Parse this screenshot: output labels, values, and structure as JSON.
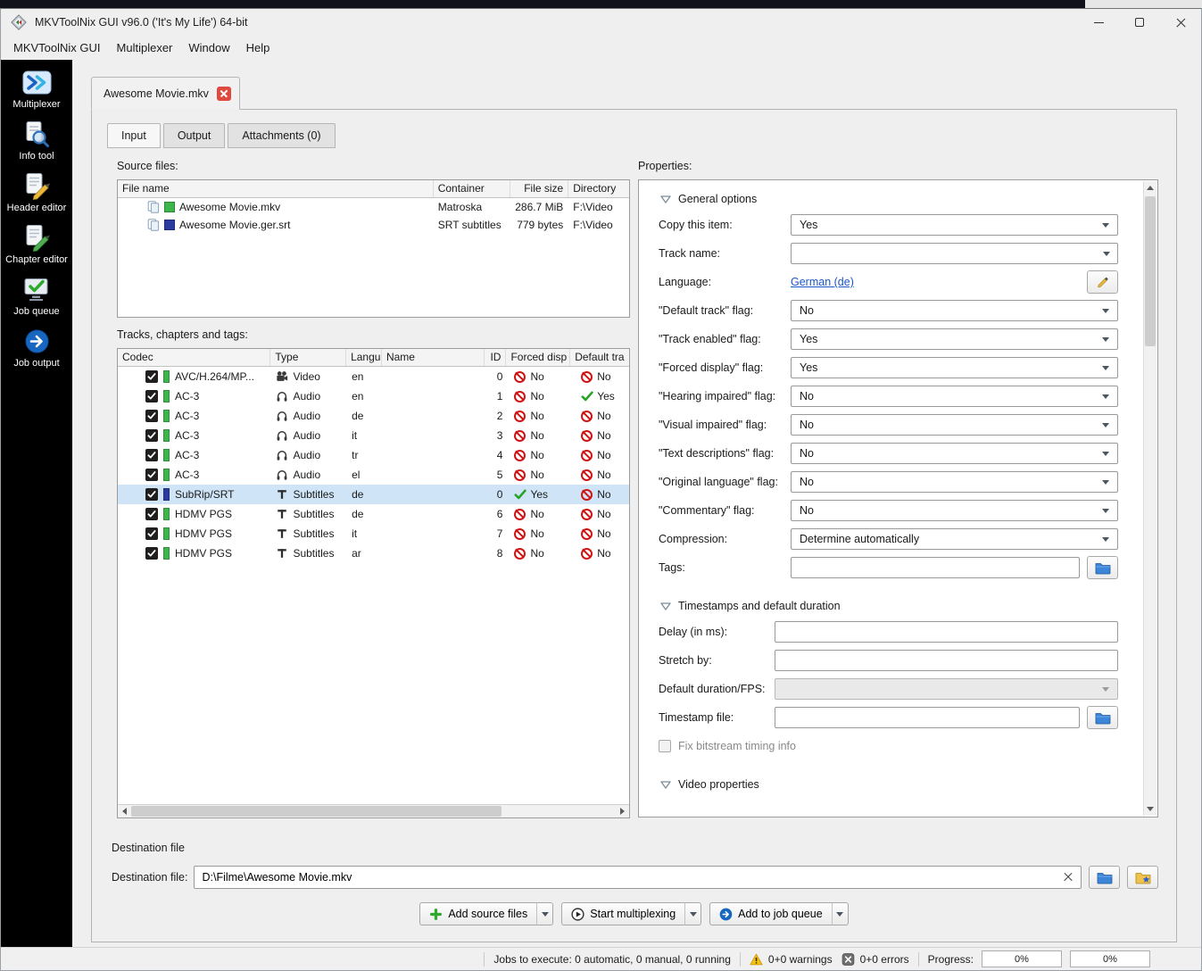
{
  "colors": {
    "selected_row": "#cfe5f7",
    "link": "#1a57c8",
    "mkv_green": "#3db54a",
    "srt_blue": "#2b3a9e",
    "tab_close_red": "#e0493e"
  },
  "win": {
    "title": "MKVToolNix GUI v96.0 ('It's My Life') 64-bit",
    "menu": [
      "MKVToolNix GUI",
      "Multiplexer",
      "Window",
      "Help"
    ]
  },
  "sidebar": {
    "items": [
      {
        "label": "Multiplexer"
      },
      {
        "label": "Info tool"
      },
      {
        "label": "Header editor"
      },
      {
        "label": "Chapter editor"
      },
      {
        "label": "Job queue"
      },
      {
        "label": "Job output"
      }
    ]
  },
  "tabs": {
    "file": "Awesome Movie.mkv",
    "input": "Input",
    "output": "Output",
    "attachments": "Attachments (0)"
  },
  "source": {
    "heading": "Source files:",
    "cols": {
      "name": "File name",
      "container": "Container",
      "size": "File size",
      "dir": "Directory"
    },
    "rows": [
      {
        "name": "Awesome Movie.mkv",
        "container": "Matroska",
        "size": "286.7 MiB",
        "dir": "F:\\Video",
        "color": "#3db54a"
      },
      {
        "name": "Awesome Movie.ger.srt",
        "container": "SRT subtitles",
        "size": "779 bytes",
        "dir": "F:\\Video",
        "color": "#2b3a9e"
      }
    ]
  },
  "tracks": {
    "heading": "Tracks, chapters and tags:",
    "cols": {
      "codec": "Codec",
      "type": "Type",
      "lang": "Langua",
      "name": "Name",
      "id": "ID",
      "forced": "Forced disp",
      "def": "Default tra"
    },
    "rows": [
      {
        "codec": "AVC/H.264/MP...",
        "type": "Video",
        "lang": "en",
        "name": "",
        "id": "0",
        "forced": "No",
        "def": "No",
        "color": "#3db54a"
      },
      {
        "codec": "AC-3",
        "type": "Audio",
        "lang": "en",
        "name": "",
        "id": "1",
        "forced": "No",
        "def": "Yes",
        "color": "#3db54a"
      },
      {
        "codec": "AC-3",
        "type": "Audio",
        "lang": "de",
        "name": "",
        "id": "2",
        "forced": "No",
        "def": "No",
        "color": "#3db54a"
      },
      {
        "codec": "AC-3",
        "type": "Audio",
        "lang": "it",
        "name": "",
        "id": "3",
        "forced": "No",
        "def": "No",
        "color": "#3db54a"
      },
      {
        "codec": "AC-3",
        "type": "Audio",
        "lang": "tr",
        "name": "",
        "id": "4",
        "forced": "No",
        "def": "No",
        "color": "#3db54a"
      },
      {
        "codec": "AC-3",
        "type": "Audio",
        "lang": "el",
        "name": "",
        "id": "5",
        "forced": "No",
        "def": "No",
        "color": "#3db54a"
      },
      {
        "codec": "SubRip/SRT",
        "type": "Subtitles",
        "lang": "de",
        "name": "",
        "id": "0",
        "forced": "Yes",
        "def": "No",
        "color": "#2b3a9e"
      },
      {
        "codec": "HDMV PGS",
        "type": "Subtitles",
        "lang": "de",
        "name": "",
        "id": "6",
        "forced": "No",
        "def": "No",
        "color": "#3db54a"
      },
      {
        "codec": "HDMV PGS",
        "type": "Subtitles",
        "lang": "it",
        "name": "",
        "id": "7",
        "forced": "No",
        "def": "No",
        "color": "#3db54a"
      },
      {
        "codec": "HDMV PGS",
        "type": "Subtitles",
        "lang": "ar",
        "name": "",
        "id": "8",
        "forced": "No",
        "def": "No",
        "color": "#3db54a"
      }
    ]
  },
  "props": {
    "heading": "Properties:",
    "general": {
      "title": "General options",
      "copy": {
        "label": "Copy this item:",
        "value": "Yes"
      },
      "track_name": {
        "label": "Track name:",
        "value": ""
      },
      "language": {
        "label": "Language:",
        "value": "German (de)"
      },
      "default_track": {
        "label": "\"Default track\" flag:",
        "value": "No"
      },
      "track_enabled": {
        "label": "\"Track enabled\" flag:",
        "value": "Yes"
      },
      "forced_display": {
        "label": "\"Forced display\" flag:",
        "value": "Yes"
      },
      "hearing": {
        "label": "\"Hearing impaired\" flag:",
        "value": "No"
      },
      "visual": {
        "label": "\"Visual impaired\" flag:",
        "value": "No"
      },
      "text_desc": {
        "label": "\"Text descriptions\" flag:",
        "value": "No"
      },
      "orig_lang": {
        "label": "\"Original language\" flag:",
        "value": "No"
      },
      "commentary": {
        "label": "\"Commentary\" flag:",
        "value": "No"
      },
      "compression": {
        "label": "Compression:",
        "value": "Determine automatically"
      },
      "tags": {
        "label": "Tags:",
        "value": ""
      }
    },
    "timestamps": {
      "title": "Timestamps and default duration",
      "delay": {
        "label": "Delay (in ms):",
        "value": ""
      },
      "stretch": {
        "label": "Stretch by:",
        "value": ""
      },
      "duration": {
        "label": "Default duration/FPS:",
        "value": ""
      },
      "ts_file": {
        "label": "Timestamp file:",
        "value": ""
      },
      "fix_bitstream": "Fix bitstream timing info"
    },
    "video": {
      "title": "Video properties"
    }
  },
  "dest": {
    "section": "Destination file",
    "label": "Destination file:",
    "value": "D:\\Filme\\Awesome Movie.mkv"
  },
  "actions": {
    "add_source": "Add source files",
    "start": "Start multiplexing",
    "queue": "Add to job queue"
  },
  "status": {
    "jobs": "Jobs to execute: 0 automatic, 0 manual, 0 running",
    "warnings": "0+0 warnings",
    "errors": "0+0 errors",
    "progress_label": "Progress:",
    "p1": "0%",
    "p2": "0%"
  }
}
